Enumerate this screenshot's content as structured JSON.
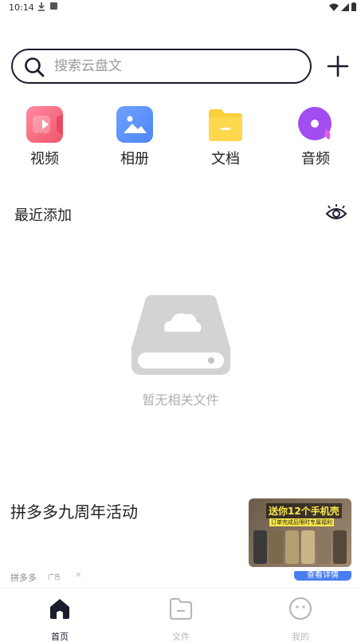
{
  "status_bar": {
    "time": "10:14"
  },
  "search": {
    "placeholder": "搜索云盘文"
  },
  "categories": [
    {
      "label": "视频",
      "icon": "video-icon",
      "color": "#f0566a"
    },
    {
      "label": "相册",
      "icon": "photo-album-icon",
      "color": "#4f86f7"
    },
    {
      "label": "文档",
      "icon": "document-folder-icon",
      "color": "#fbcf3a"
    },
    {
      "label": "音频",
      "icon": "audio-icon",
      "color": "#a14df0"
    }
  ],
  "recent": {
    "title": "最近添加"
  },
  "empty_state": {
    "message": "暂无相关文件"
  },
  "ad": {
    "title": "拼多多九周年活动",
    "brand": "拼多多",
    "tag": "广告",
    "image_headline": "送你12个手机壳",
    "image_subline": "订单完成后限时专属福利",
    "detail_label": "查看详情"
  },
  "tabs": [
    {
      "label": "首页",
      "icon": "home-icon",
      "active": true
    },
    {
      "label": "文件",
      "icon": "folder-icon",
      "active": false
    },
    {
      "label": "我的",
      "icon": "profile-icon",
      "active": false
    }
  ],
  "colors": {
    "accent": "#1b1b2e",
    "inactive": "#b8b8b8",
    "ad_button": "#4a7df0"
  }
}
